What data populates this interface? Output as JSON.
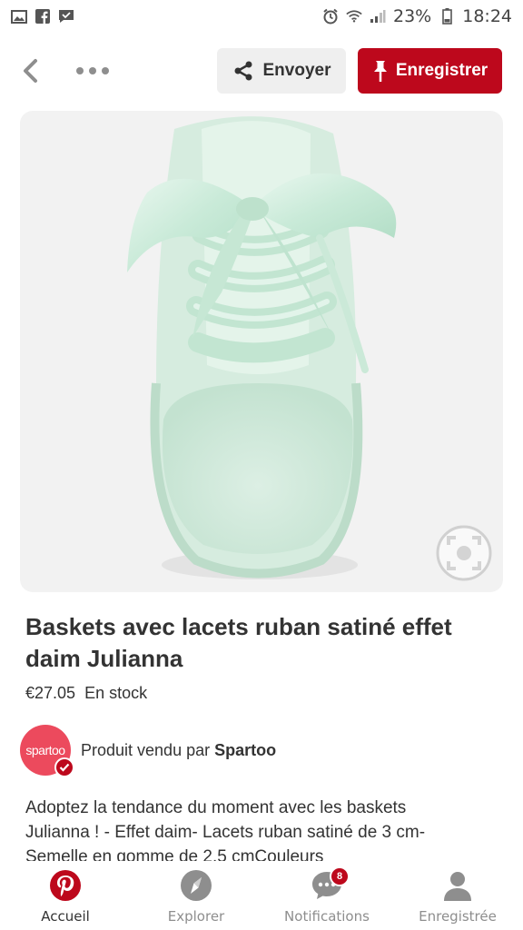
{
  "status_bar": {
    "left_icons": [
      "image-icon",
      "facebook-icon",
      "message-icon"
    ],
    "right_icons": [
      "alarm-icon",
      "wifi-icon",
      "signal-icon",
      "battery-icon"
    ],
    "battery": "23%",
    "time": "18:24"
  },
  "toolbar": {
    "send_label": "Envoyer",
    "save_label": "Enregistrer"
  },
  "product": {
    "title": "Baskets avec lacets ruban satiné effet daim Julianna",
    "price": "€27.05",
    "stock": "En stock",
    "image_icon": "shoe-image",
    "lens_icon": "visual-search-icon"
  },
  "seller": {
    "avatar_text": "spartoo",
    "prefix": "Produit vendu par ",
    "name": "Spartoo"
  },
  "description": "Adoptez la tendance du moment avec les baskets Julianna ! - Effet daim- Lacets ruban satiné de 3 cm- Semelle en gomme de 2.5 cmCouleurs",
  "bottom_nav": {
    "items": [
      {
        "label": "Accueil",
        "icon": "pinterest-icon"
      },
      {
        "label": "Explorer",
        "icon": "compass-icon"
      },
      {
        "label": "Notifications",
        "icon": "chat-icon",
        "badge": "8"
      },
      {
        "label": "Enregistrée",
        "icon": "profile-icon"
      }
    ]
  },
  "colors": {
    "brand": "#bd081c",
    "text": "#333333",
    "muted": "#8e8e8e",
    "image_bg": "#f2f2f2"
  }
}
